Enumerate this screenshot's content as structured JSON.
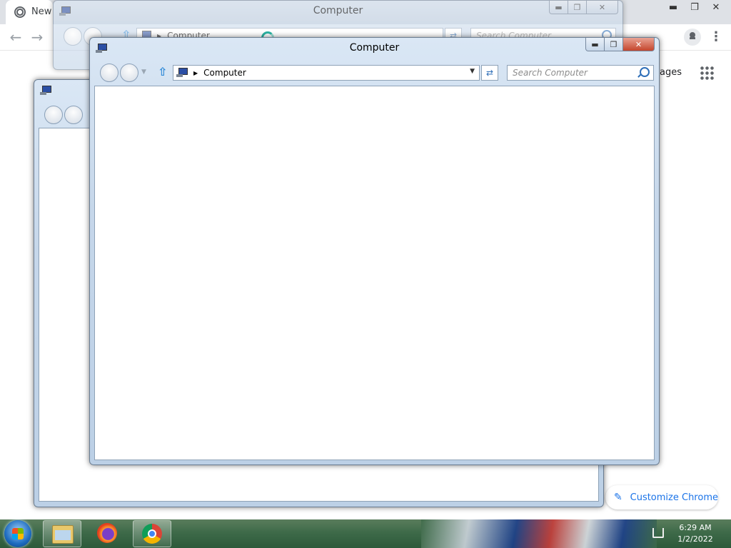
{
  "chrome": {
    "tab_label": "New",
    "images_link": "ages",
    "customize_label": "Customize Chrome"
  },
  "back_window": {
    "title": "Computer",
    "address": "Computer",
    "search_placeholder": "Search Computer"
  },
  "middle_window": {
    "title": ""
  },
  "front_window": {
    "title": "Computer",
    "address": "Computer",
    "search_placeholder": "Search Computer"
  },
  "taskbar": {
    "pinned": [
      "windows-explorer",
      "firefox",
      "google-chrome"
    ],
    "clock_time": "6:29 AM",
    "clock_date": "1/2/2022"
  },
  "colors": {
    "chrome_accent": "#1a73e8",
    "close_button_active": "#c4452d",
    "taskbar": "#3e6a49"
  }
}
